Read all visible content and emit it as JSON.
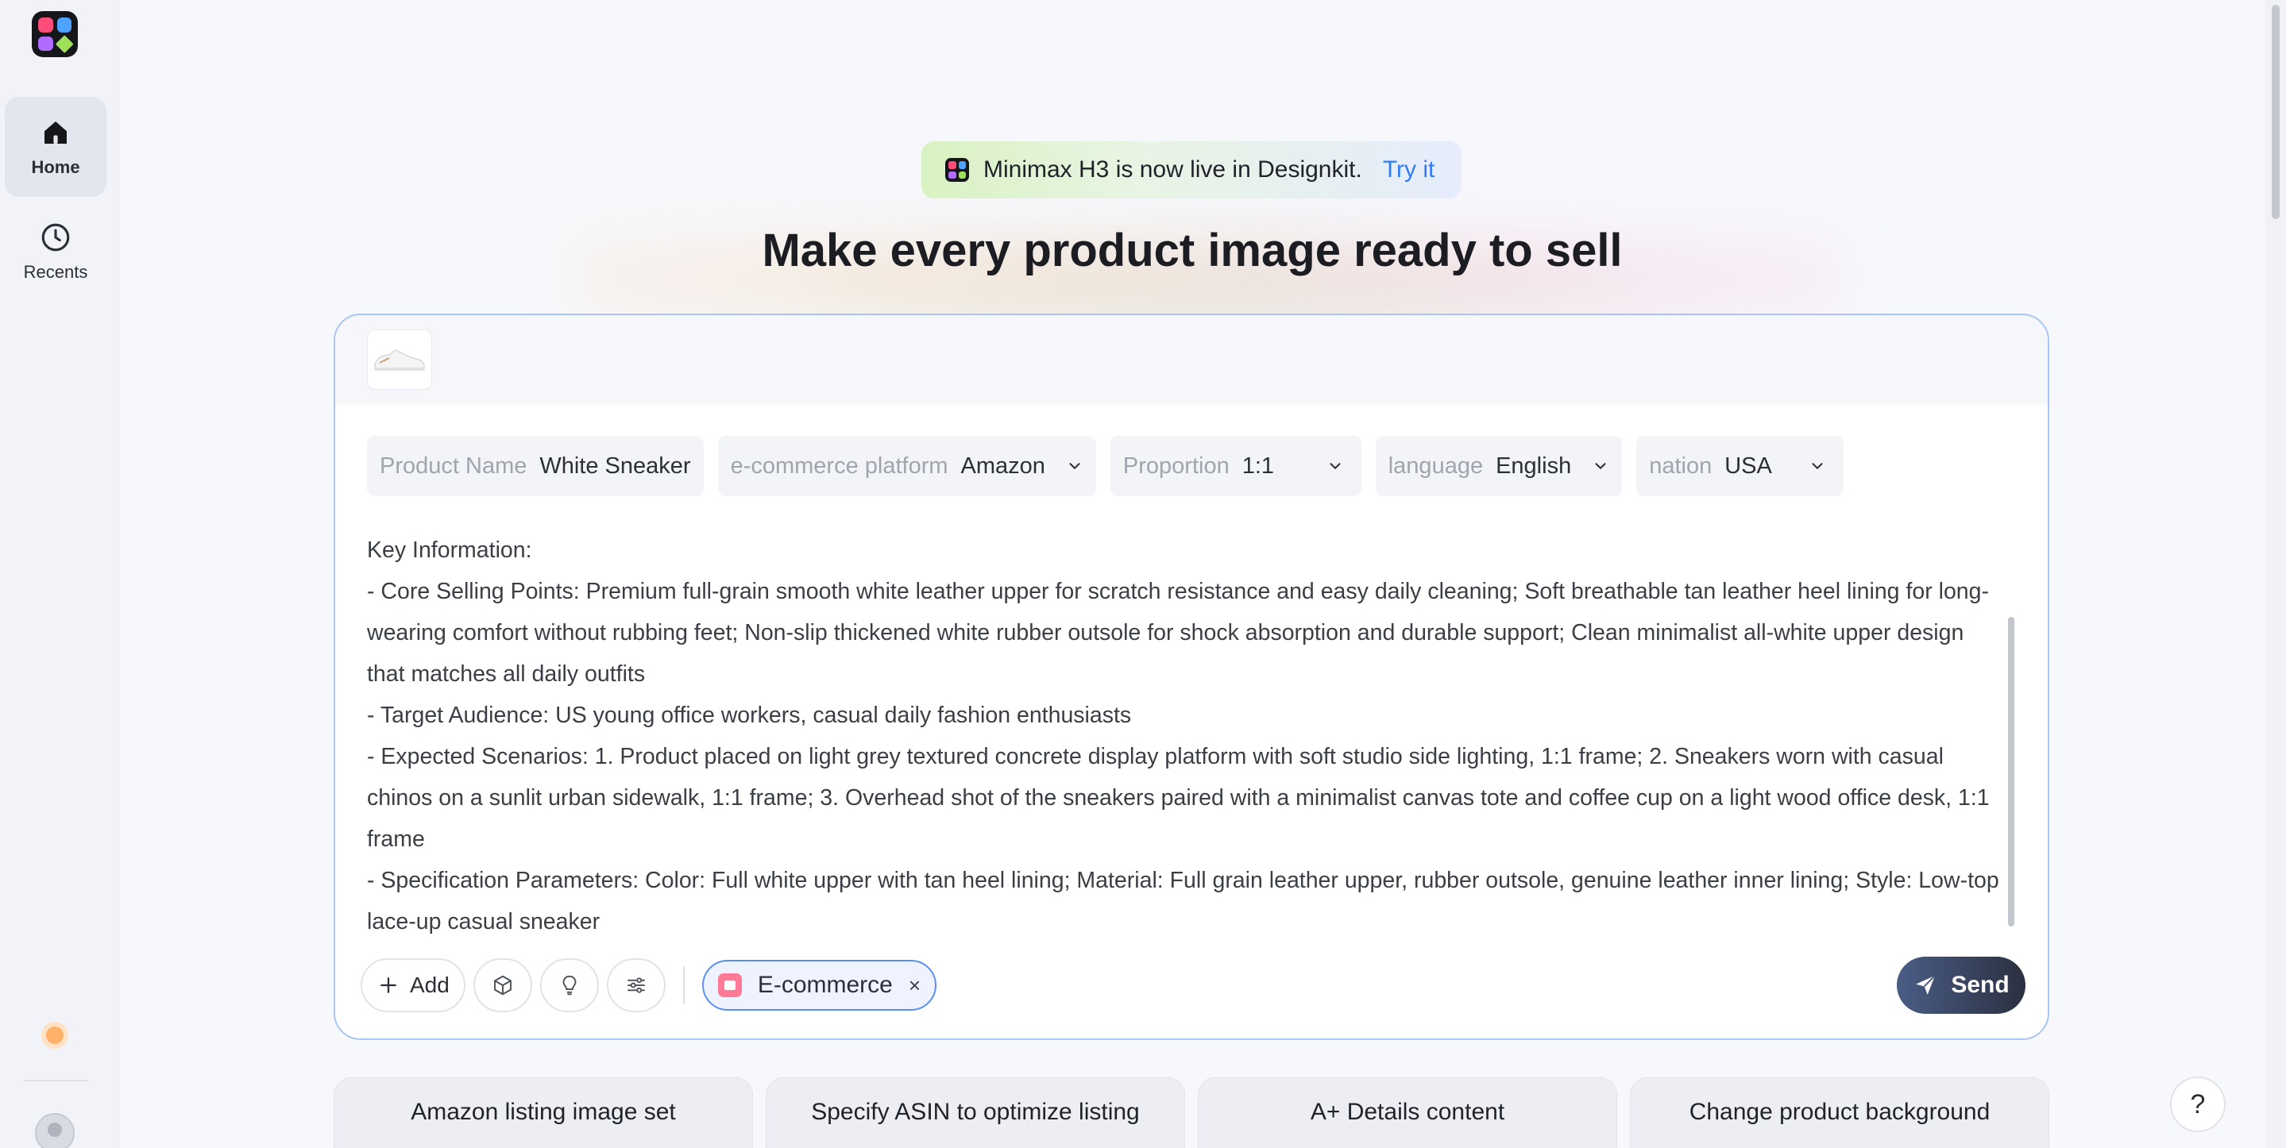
{
  "sidebar": {
    "items": [
      {
        "label": "Home",
        "icon": "home-icon",
        "active": true
      },
      {
        "label": "Recents",
        "icon": "clock-icon",
        "active": false
      }
    ]
  },
  "announcement": {
    "text": "Minimax H3 is now live in Designkit.",
    "link": "Try it"
  },
  "headline": "Make every product image ready to sell",
  "params": [
    {
      "label": "Product Name",
      "value": "White Sneaker",
      "dropdown": false
    },
    {
      "label": "e-commerce platform",
      "value": "Amazon",
      "dropdown": true
    },
    {
      "label": "Proportion",
      "value": "1:1",
      "dropdown": true
    },
    {
      "label": "language",
      "value": "English",
      "dropdown": true
    },
    {
      "label": "nation",
      "value": "USA",
      "dropdown": true
    }
  ],
  "prompt": {
    "text": "Key Information:\n- Core Selling Points: Premium full-grain smooth white leather upper for scratch resistance and easy daily cleaning; Soft breathable tan leather heel lining for long-wearing comfort without rubbing feet; Non-slip thickened white rubber outsole for shock absorption and durable support; Clean minimalist all-white upper design that matches all daily outfits\n- Target Audience: US young office workers, casual daily fashion enthusiasts\n- Expected Scenarios: 1. Product placed on light grey textured concrete display platform with soft studio side lighting, 1:1 frame; 2. Sneakers worn with casual chinos on a sunlit urban sidewalk, 1:1 frame; 3. Overhead shot of the sneakers paired with a minimalist canvas tote and coffee cup on a light wood office desk, 1:1 frame\n- Specification Parameters: Color: Full white upper with tan heel lining; Material: Full grain leather upper, rubber outsole, genuine leather inner lining; Style: Low-top lace-up casual sneaker"
  },
  "toolbar": {
    "add_label": "Add",
    "chip_label": "E-commerce",
    "chip_close": "×",
    "send_label": "Send"
  },
  "tiles": [
    "Amazon listing image set",
    "Specify ASIN to optimize listing",
    "A+ Details content",
    "Change product background"
  ],
  "help_label": "?",
  "colors": {
    "accent": "#2f7cf6",
    "card_border": "#a9c5f3",
    "send_bg": "#2b3040"
  }
}
